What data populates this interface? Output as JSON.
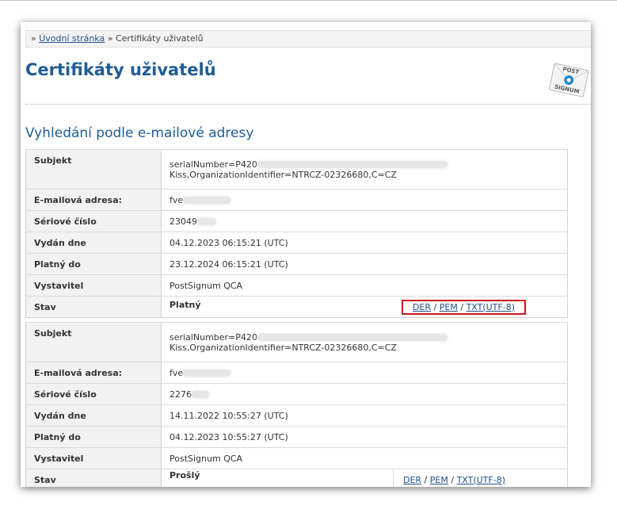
{
  "breadcrumb": {
    "prefix": "»",
    "home_link": "Úvodní stránka",
    "separator": "»",
    "current": "Certifikáty uživatelů"
  },
  "page_title": "Certifikáty uživatelů",
  "logo": {
    "line1": "POST",
    "line2": "SIGNUM"
  },
  "section_title": "Vyhledání podle e-mailové adresy",
  "labels": {
    "subject": "Subjekt",
    "email": "E-mailová adresa:",
    "serial": "Sériové číslo",
    "issued": "Vydán dne",
    "valid_to": "Platný do",
    "issuer": "Vystavitel",
    "status": "Stav"
  },
  "links": {
    "der": "DER",
    "pem": "PEM",
    "txt": "TXT(UTF-8)",
    "sep": "/"
  },
  "certificates": [
    {
      "subject_line1": "serialNumber=P420",
      "subject_line2": "Kiss,OrganizationIdentifier=NTRCZ-02326680,C=CZ",
      "email": "fve",
      "serial": "23049",
      "issued": "04.12.2023 06:15:21 (UTC)",
      "valid_to": "23.12.2024 06:15:21 (UTC)",
      "issuer": "PostSignum QCA",
      "status": "Platný"
    },
    {
      "subject_line1": "serialNumber=P420",
      "subject_line2": "Kiss,OrganizationIdentifier=NTRCZ-02326680,C=CZ",
      "email": "fve",
      "serial": "2276",
      "issued": "14.11.2022 10:55:27 (UTC)",
      "valid_to": "04.12.2023 10:55:27 (UTC)",
      "issuer": "PostSignum QCA",
      "status": "Prošlý"
    }
  ],
  "colors": {
    "title": "#1f5c95",
    "link": "#1f4f8a",
    "highlight": "#d1151a"
  }
}
